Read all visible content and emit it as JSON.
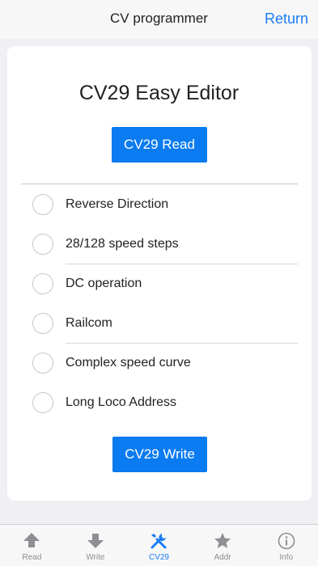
{
  "header": {
    "title": "CV programmer",
    "return_label": "Return"
  },
  "card": {
    "title": "CV29 Easy Editor",
    "read_button": "CV29 Read",
    "write_button": "CV29 Write",
    "options": [
      {
        "label": "Reverse Direction",
        "checked": false
      },
      {
        "label": "28/128 speed steps",
        "checked": false
      },
      {
        "label": "DC operation",
        "checked": false
      },
      {
        "label": "Railcom",
        "checked": false
      },
      {
        "label": "Complex speed curve",
        "checked": false
      },
      {
        "label": "Long Loco Address",
        "checked": false
      }
    ]
  },
  "tabs": [
    {
      "label": "Read",
      "icon": "arrow-up-icon"
    },
    {
      "label": "Write",
      "icon": "arrow-down-icon"
    },
    {
      "label": "CV29",
      "icon": "tools-icon",
      "active": true
    },
    {
      "label": "Addr",
      "icon": "star-icon"
    },
    {
      "label": "Info",
      "icon": "info-icon"
    }
  ],
  "colors": {
    "accent": "#1a7cf5",
    "button": "#0a7bf0",
    "background": "#efeff4",
    "inactive_tab": "#8e8e93"
  }
}
